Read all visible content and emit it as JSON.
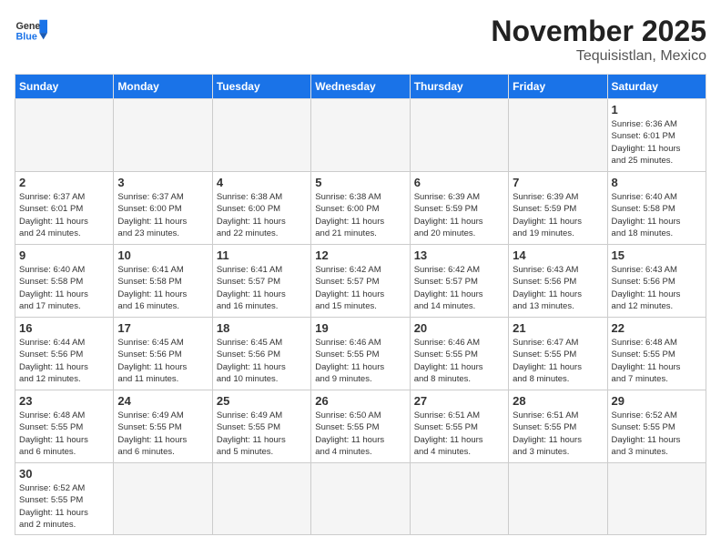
{
  "header": {
    "logo_general": "General",
    "logo_blue": "Blue",
    "title": "November 2025",
    "subtitle": "Tequisistlan, Mexico"
  },
  "days_of_week": [
    "Sunday",
    "Monday",
    "Tuesday",
    "Wednesday",
    "Thursday",
    "Friday",
    "Saturday"
  ],
  "weeks": [
    [
      {
        "day": "",
        "info": ""
      },
      {
        "day": "",
        "info": ""
      },
      {
        "day": "",
        "info": ""
      },
      {
        "day": "",
        "info": ""
      },
      {
        "day": "",
        "info": ""
      },
      {
        "day": "",
        "info": ""
      },
      {
        "day": "1",
        "info": "Sunrise: 6:36 AM\nSunset: 6:01 PM\nDaylight: 11 hours\nand 25 minutes."
      }
    ],
    [
      {
        "day": "2",
        "info": "Sunrise: 6:37 AM\nSunset: 6:01 PM\nDaylight: 11 hours\nand 24 minutes."
      },
      {
        "day": "3",
        "info": "Sunrise: 6:37 AM\nSunset: 6:00 PM\nDaylight: 11 hours\nand 23 minutes."
      },
      {
        "day": "4",
        "info": "Sunrise: 6:38 AM\nSunset: 6:00 PM\nDaylight: 11 hours\nand 22 minutes."
      },
      {
        "day": "5",
        "info": "Sunrise: 6:38 AM\nSunset: 6:00 PM\nDaylight: 11 hours\nand 21 minutes."
      },
      {
        "day": "6",
        "info": "Sunrise: 6:39 AM\nSunset: 5:59 PM\nDaylight: 11 hours\nand 20 minutes."
      },
      {
        "day": "7",
        "info": "Sunrise: 6:39 AM\nSunset: 5:59 PM\nDaylight: 11 hours\nand 19 minutes."
      },
      {
        "day": "8",
        "info": "Sunrise: 6:40 AM\nSunset: 5:58 PM\nDaylight: 11 hours\nand 18 minutes."
      }
    ],
    [
      {
        "day": "9",
        "info": "Sunrise: 6:40 AM\nSunset: 5:58 PM\nDaylight: 11 hours\nand 17 minutes."
      },
      {
        "day": "10",
        "info": "Sunrise: 6:41 AM\nSunset: 5:58 PM\nDaylight: 11 hours\nand 16 minutes."
      },
      {
        "day": "11",
        "info": "Sunrise: 6:41 AM\nSunset: 5:57 PM\nDaylight: 11 hours\nand 16 minutes."
      },
      {
        "day": "12",
        "info": "Sunrise: 6:42 AM\nSunset: 5:57 PM\nDaylight: 11 hours\nand 15 minutes."
      },
      {
        "day": "13",
        "info": "Sunrise: 6:42 AM\nSunset: 5:57 PM\nDaylight: 11 hours\nand 14 minutes."
      },
      {
        "day": "14",
        "info": "Sunrise: 6:43 AM\nSunset: 5:56 PM\nDaylight: 11 hours\nand 13 minutes."
      },
      {
        "day": "15",
        "info": "Sunrise: 6:43 AM\nSunset: 5:56 PM\nDaylight: 11 hours\nand 12 minutes."
      }
    ],
    [
      {
        "day": "16",
        "info": "Sunrise: 6:44 AM\nSunset: 5:56 PM\nDaylight: 11 hours\nand 12 minutes."
      },
      {
        "day": "17",
        "info": "Sunrise: 6:45 AM\nSunset: 5:56 PM\nDaylight: 11 hours\nand 11 minutes."
      },
      {
        "day": "18",
        "info": "Sunrise: 6:45 AM\nSunset: 5:56 PM\nDaylight: 11 hours\nand 10 minutes."
      },
      {
        "day": "19",
        "info": "Sunrise: 6:46 AM\nSunset: 5:55 PM\nDaylight: 11 hours\nand 9 minutes."
      },
      {
        "day": "20",
        "info": "Sunrise: 6:46 AM\nSunset: 5:55 PM\nDaylight: 11 hours\nand 8 minutes."
      },
      {
        "day": "21",
        "info": "Sunrise: 6:47 AM\nSunset: 5:55 PM\nDaylight: 11 hours\nand 8 minutes."
      },
      {
        "day": "22",
        "info": "Sunrise: 6:48 AM\nSunset: 5:55 PM\nDaylight: 11 hours\nand 7 minutes."
      }
    ],
    [
      {
        "day": "23",
        "info": "Sunrise: 6:48 AM\nSunset: 5:55 PM\nDaylight: 11 hours\nand 6 minutes."
      },
      {
        "day": "24",
        "info": "Sunrise: 6:49 AM\nSunset: 5:55 PM\nDaylight: 11 hours\nand 6 minutes."
      },
      {
        "day": "25",
        "info": "Sunrise: 6:49 AM\nSunset: 5:55 PM\nDaylight: 11 hours\nand 5 minutes."
      },
      {
        "day": "26",
        "info": "Sunrise: 6:50 AM\nSunset: 5:55 PM\nDaylight: 11 hours\nand 4 minutes."
      },
      {
        "day": "27",
        "info": "Sunrise: 6:51 AM\nSunset: 5:55 PM\nDaylight: 11 hours\nand 4 minutes."
      },
      {
        "day": "28",
        "info": "Sunrise: 6:51 AM\nSunset: 5:55 PM\nDaylight: 11 hours\nand 3 minutes."
      },
      {
        "day": "29",
        "info": "Sunrise: 6:52 AM\nSunset: 5:55 PM\nDaylight: 11 hours\nand 3 minutes."
      }
    ],
    [
      {
        "day": "30",
        "info": "Sunrise: 6:52 AM\nSunset: 5:55 PM\nDaylight: 11 hours\nand 2 minutes."
      },
      {
        "day": "",
        "info": ""
      },
      {
        "day": "",
        "info": ""
      },
      {
        "day": "",
        "info": ""
      },
      {
        "day": "",
        "info": ""
      },
      {
        "day": "",
        "info": ""
      },
      {
        "day": "",
        "info": ""
      }
    ]
  ]
}
